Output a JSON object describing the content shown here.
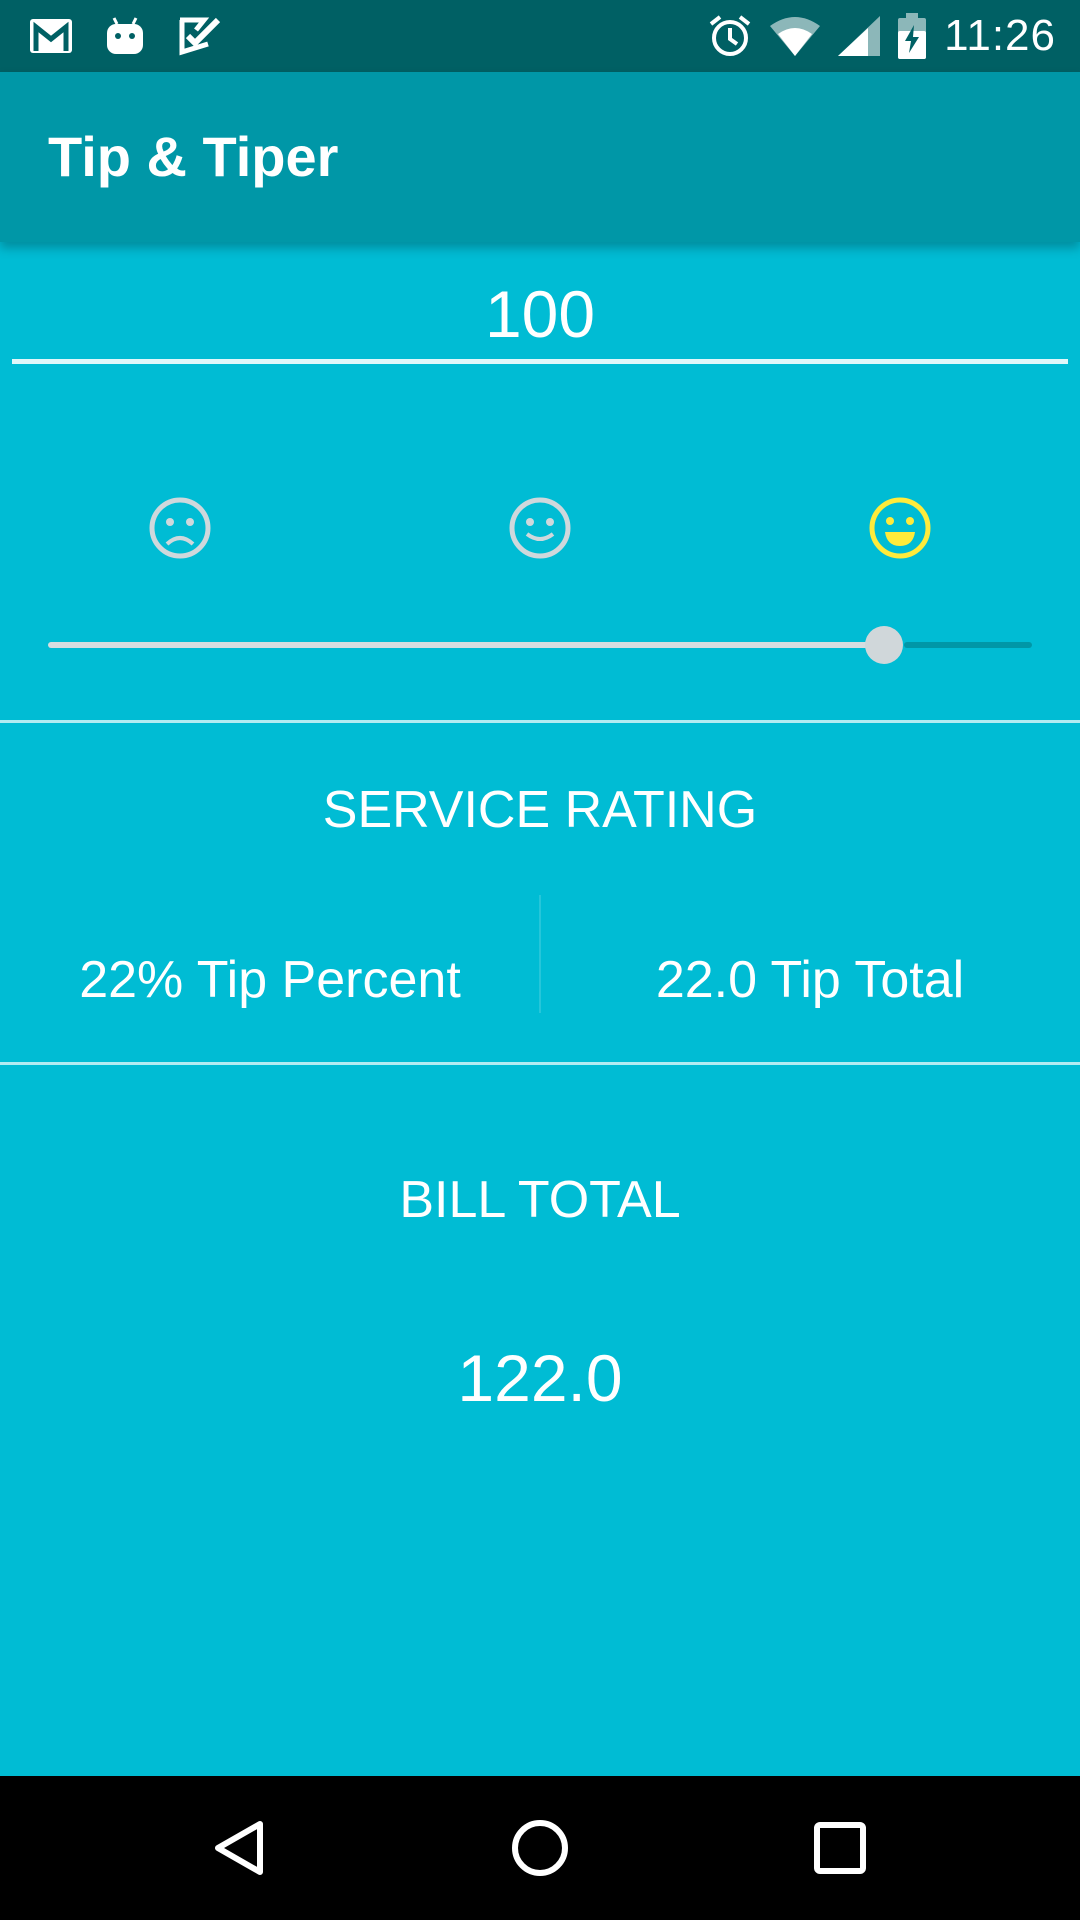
{
  "status_bar": {
    "time": "11:26",
    "left_icons": [
      "gmail-icon",
      "android-icon",
      "task-check-icon"
    ],
    "right_icons": [
      "alarm-icon",
      "wifi-icon",
      "signal-icon",
      "battery-charging-icon"
    ]
  },
  "app_bar": {
    "title": "Tip & Tiper"
  },
  "bill_input": {
    "value": "100"
  },
  "rating": {
    "faces": [
      "sad-face-icon",
      "neutral-face-icon",
      "happy-face-icon"
    ],
    "selected": "happy-face-icon",
    "slider_value": 0.85,
    "selected_color": "#ffeb3b"
  },
  "service": {
    "label": "SERVICE RATING",
    "tip_percent": "22% Tip Percent",
    "tip_total": "22.0 Tip Total"
  },
  "bill_total": {
    "label": "BILL TOTAL",
    "value": "122.0"
  },
  "nav_bar": {
    "buttons": [
      "back-icon",
      "home-icon",
      "recents-icon"
    ]
  },
  "colors": {
    "status_bar": "#006064",
    "app_bar": "#0097a7",
    "background": "#00bcd4",
    "nav_bar": "#000000"
  }
}
